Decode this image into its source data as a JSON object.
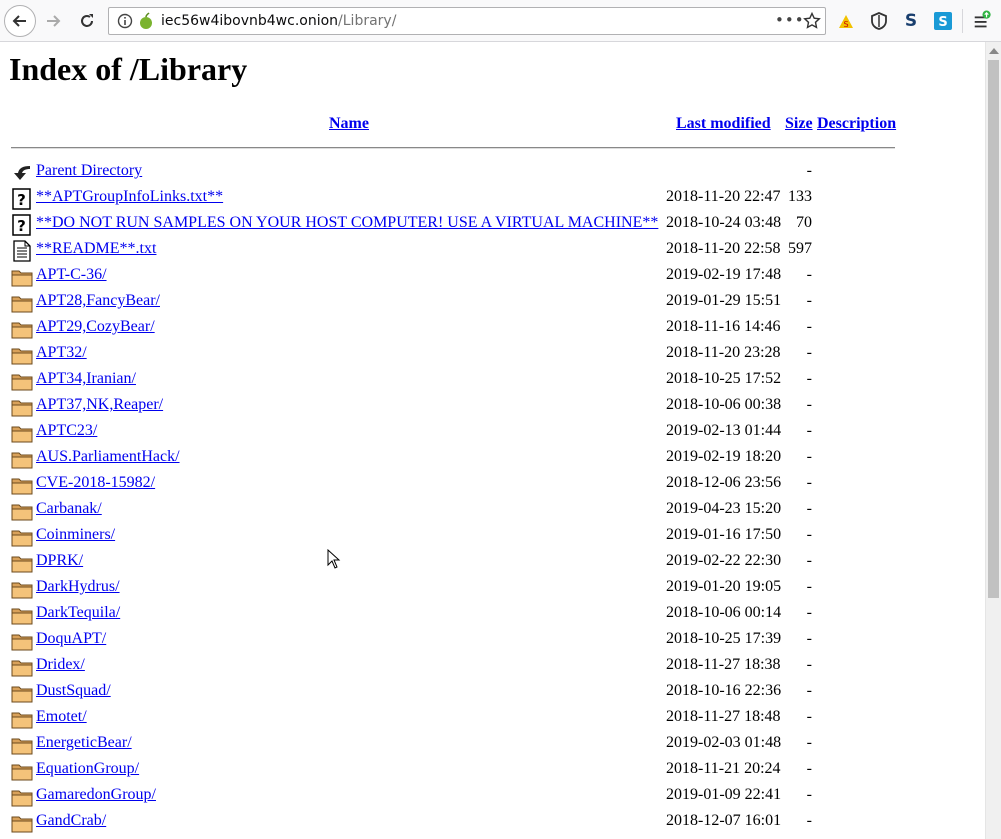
{
  "browser": {
    "url_host": "iec56w4ibovnb4wc.onion",
    "url_path": "/Library/"
  },
  "page": {
    "title": "Index of /Library",
    "headers": {
      "name": "Name",
      "modified": "Last modified",
      "size": "Size",
      "description": "Description"
    },
    "parent": {
      "label": "Parent Directory",
      "size": "-"
    },
    "rows": [
      {
        "name": "**APTGroupInfoLinks.txt**",
        "date": "2018-11-20 22:47",
        "size": "133",
        "icon": "unknown-file-icon"
      },
      {
        "name": "**DO NOT RUN SAMPLES ON YOUR HOST COMPUTER! USE A VIRTUAL MACHINE**",
        "date": "2018-10-24 03:48",
        "size": "70",
        "icon": "unknown-file-icon"
      },
      {
        "name": "**README**.txt",
        "date": "2018-11-20 22:58",
        "size": "597",
        "icon": "text-file-icon"
      },
      {
        "name": "APT-C-36/",
        "date": "2019-02-19 17:48",
        "size": "-",
        "icon": "folder-icon"
      },
      {
        "name": "APT28,FancyBear/",
        "date": "2019-01-29 15:51",
        "size": "-",
        "icon": "folder-icon"
      },
      {
        "name": "APT29,CozyBear/",
        "date": "2018-11-16 14:46",
        "size": "-",
        "icon": "folder-icon"
      },
      {
        "name": "APT32/",
        "date": "2018-11-20 23:28",
        "size": "-",
        "icon": "folder-icon"
      },
      {
        "name": "APT34,Iranian/",
        "date": "2018-10-25 17:52",
        "size": "-",
        "icon": "folder-icon"
      },
      {
        "name": "APT37,NK,Reaper/",
        "date": "2018-10-06 00:38",
        "size": "-",
        "icon": "folder-icon"
      },
      {
        "name": "APTC23/",
        "date": "2019-02-13 01:44",
        "size": "-",
        "icon": "folder-icon"
      },
      {
        "name": "AUS.ParliamentHack/",
        "date": "2019-02-19 18:20",
        "size": "-",
        "icon": "folder-icon"
      },
      {
        "name": "CVE-2018-15982/",
        "date": "2018-12-06 23:56",
        "size": "-",
        "icon": "folder-icon"
      },
      {
        "name": "Carbanak/",
        "date": "2019-04-23 15:20",
        "size": "-",
        "icon": "folder-icon"
      },
      {
        "name": "Coinminers/",
        "date": "2019-01-16 17:50",
        "size": "-",
        "icon": "folder-icon"
      },
      {
        "name": "DPRK/",
        "date": "2019-02-22 22:30",
        "size": "-",
        "icon": "folder-icon"
      },
      {
        "name": "DarkHydrus/",
        "date": "2019-01-20 19:05",
        "size": "-",
        "icon": "folder-icon"
      },
      {
        "name": "DarkTequila/",
        "date": "2018-10-06 00:14",
        "size": "-",
        "icon": "folder-icon"
      },
      {
        "name": "DoquAPT/",
        "date": "2018-10-25 17:39",
        "size": "-",
        "icon": "folder-icon"
      },
      {
        "name": "Dridex/",
        "date": "2018-11-27 18:38",
        "size": "-",
        "icon": "folder-icon"
      },
      {
        "name": "DustSquad/",
        "date": "2018-10-16 22:36",
        "size": "-",
        "icon": "folder-icon"
      },
      {
        "name": "Emotet/",
        "date": "2018-11-27 18:48",
        "size": "-",
        "icon": "folder-icon"
      },
      {
        "name": "EnergeticBear/",
        "date": "2019-02-03 01:48",
        "size": "-",
        "icon": "folder-icon"
      },
      {
        "name": "EquationGroup/",
        "date": "2018-11-21 20:24",
        "size": "-",
        "icon": "folder-icon"
      },
      {
        "name": "GamaredonGroup/",
        "date": "2019-01-09 22:41",
        "size": "-",
        "icon": "folder-icon"
      },
      {
        "name": "GandCrab/",
        "date": "2018-12-07 16:01",
        "size": "-",
        "icon": "folder-icon"
      }
    ]
  }
}
